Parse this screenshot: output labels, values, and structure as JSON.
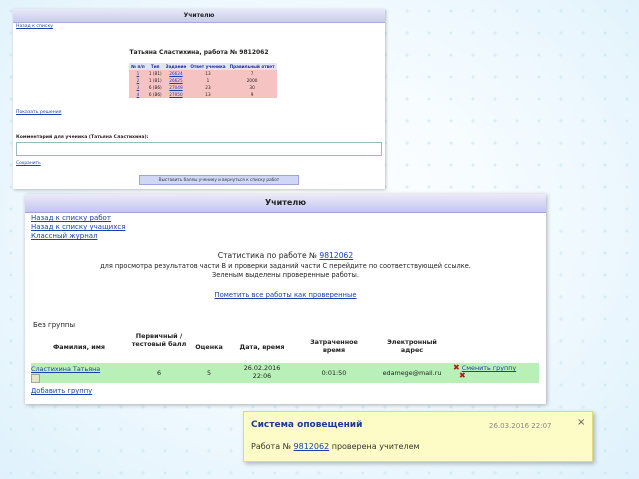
{
  "panel1": {
    "header": "Учителю",
    "back_link": "Назад к списку",
    "title": "Татьяна Сластихина, работа № 9812062",
    "table": {
      "headers": [
        "№ п/п",
        "Тип",
        "Задание",
        "Ответ ученика",
        "Правильный ответ"
      ],
      "rows": [
        [
          "1",
          "1 (B1)",
          "26624",
          "13",
          "7"
        ],
        [
          "2",
          "1 (B1)",
          "26625",
          "1",
          "2000"
        ],
        [
          "3",
          "6 (B6)",
          "27049",
          "23",
          "30"
        ],
        [
          "4",
          "6 (B6)",
          "27050",
          "13",
          "9"
        ]
      ]
    },
    "show_solutions": "Показать решения",
    "comment_label": "Комментарий для ученика (Татьяна Сластихина):",
    "save_link": "Сохранить",
    "set_button": "Выставить баллы ученику и вернуться к списку работ"
  },
  "panel2": {
    "header": "Учителю",
    "nav": [
      "Назад к списку работ",
      "Назад к списку учащихся",
      "Классный журнал"
    ],
    "title_prefix": "Статистика по работе №",
    "title_number": "9812062",
    "instructions_1": "для просмотра результатов части В и проверки заданий части С перейдите по соответствующей ссылке.",
    "instructions_2": "Зеленым выделены проверенные работы.",
    "mark_all": "Пометить все работы как проверенные",
    "no_group": "Без группы",
    "columns": {
      "name": "Фамилия, имя",
      "primary": "Первичный / тестовый балл",
      "grade": "Оценка",
      "datetime": "Дата, время",
      "time_spent": "Затраченное время",
      "email": "Электронный адрес"
    },
    "row": {
      "name": "Сластихина Татьяна",
      "primary": "6",
      "grade": "5",
      "date": "26.02.2016",
      "time": "22:06",
      "time_spent": "0:01:50",
      "email": "edamege@mail.ru",
      "change_group": "Сменить группу"
    },
    "add_group": "Добавить группу"
  },
  "notification": {
    "title": "Система оповещений",
    "timestamp": "26.03.2016 22:07",
    "close": "×",
    "text_prefix": "Работа №",
    "number": "9812062",
    "text_suffix": "проверена учителем"
  },
  "colors": {
    "header_bg": "#c9cbef",
    "row_checked": "#b8f0b8",
    "row_incorrect": "#f6c3c3",
    "notification_bg": "#fdfbc6",
    "link": "#1a3fb0"
  }
}
